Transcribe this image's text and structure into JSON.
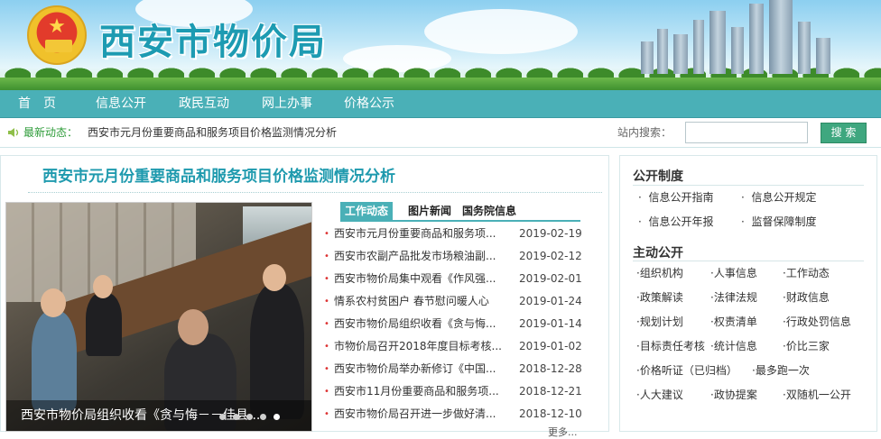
{
  "header": {
    "site_title": "西安市物价局"
  },
  "nav": {
    "items": [
      {
        "label": "首　页"
      },
      {
        "label": "信息公开"
      },
      {
        "label": "政民互动"
      },
      {
        "label": "网上办事"
      },
      {
        "label": "价格公示"
      }
    ]
  },
  "ticker": {
    "label": "最新动态：",
    "text": "西安市元月份重要商品和服务项目价格监测情况分析",
    "search_label": "站内搜索：",
    "search_value": "",
    "search_button": "搜 索"
  },
  "main": {
    "article_title": "西安市元月份重要商品和服务项目价格监测情况分析",
    "photo_caption": "西安市物价局组织收看《贪与悔－－佳县...",
    "tabs": [
      {
        "label": "工作动态",
        "active": true
      },
      {
        "label": "图片新闻",
        "active": false
      },
      {
        "label": "国务院信息",
        "active": false
      }
    ],
    "news": [
      {
        "title": "西安市元月份重要商品和服务项...",
        "date": "2019-02-19"
      },
      {
        "title": "西安市农副产品批发市场粮油副...",
        "date": "2019-02-12"
      },
      {
        "title": "西安市物价局集中观看《作风强...",
        "date": "2019-02-01"
      },
      {
        "title": "情系农村贫困户 春节慰问暖人心",
        "date": "2019-01-24"
      },
      {
        "title": "西安市物价局组织收看《贪与悔...",
        "date": "2019-01-14"
      },
      {
        "title": "市物价局召开2018年度目标考核...",
        "date": "2019-01-02"
      },
      {
        "title": "西安市物价局举办新修订《中国...",
        "date": "2018-12-28"
      },
      {
        "title": "西安市11月份重要商品和服务项...",
        "date": "2018-12-21"
      },
      {
        "title": "西安市物价局召开进一步做好清...",
        "date": "2018-12-10"
      }
    ],
    "more": "更多..."
  },
  "sidebar": {
    "section1_title": "公开制度",
    "section1_links": [
      "信息公开指南",
      "信息公开规定",
      "信息公开年报",
      "监督保障制度"
    ],
    "section2_title": "主动公开",
    "section2_links": [
      "组织机构",
      "人事信息",
      "工作动态",
      "政策解读",
      "法律法规",
      "财政信息",
      "规划计划",
      "权责清单",
      "行政处罚信息",
      "目标责任考核",
      "统计信息",
      "价比三家",
      "价格听证（已归档）",
      "最多跑一次",
      "人大建议",
      "政协提案",
      "双随机一公开"
    ]
  },
  "colors": {
    "nav": "#4ab0b7",
    "title": "#1f9aae",
    "search_button": "#3fa77f"
  }
}
